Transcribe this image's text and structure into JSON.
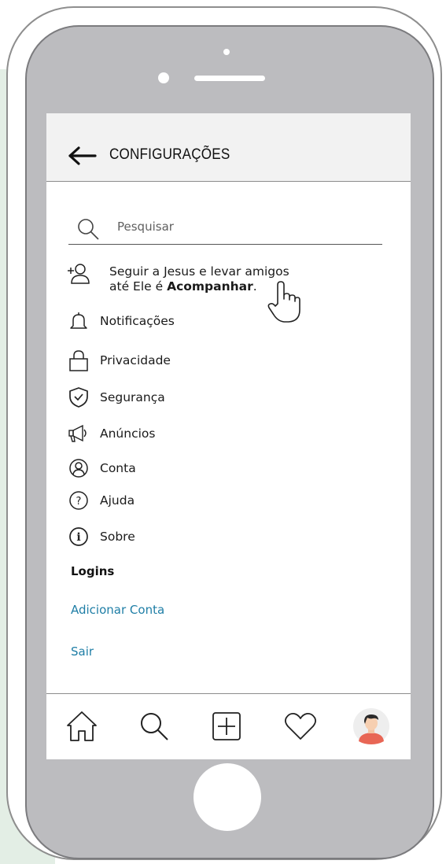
{
  "header": {
    "title": "CONFIGURAÇÕES",
    "back_icon": "arrow-left-icon"
  },
  "search": {
    "placeholder": "Pesquisar",
    "icon": "search-icon"
  },
  "follow": {
    "icon": "add-user-icon",
    "line1": "Seguir a Jesus e levar amigos",
    "line2_prefix": "até Ele é ",
    "line2_bold": "Acompanhar",
    "line2_suffix": ".",
    "cursor_icon": "hand-pointer-icon"
  },
  "menu": {
    "items": [
      {
        "label": "Notificações",
        "icon": "bell-icon"
      },
      {
        "label": "Privacidade",
        "icon": "lock-icon"
      },
      {
        "label": "Segurança",
        "icon": "shield-icon"
      },
      {
        "label": "Anúncios",
        "icon": "megaphone-icon"
      },
      {
        "label": "Conta",
        "icon": "account-icon"
      },
      {
        "label": "Ajuda",
        "icon": "help-icon"
      },
      {
        "label": "Sobre",
        "icon": "info-icon"
      }
    ]
  },
  "logins": {
    "heading": "Logins",
    "add_account": "Adicionar Conta",
    "logout": "Sair"
  },
  "colors": {
    "link": "#1f7ea6",
    "phone_body": "#bcbcbf",
    "background_panel": "#e3eee5"
  },
  "bottom_nav": [
    "home-icon",
    "search-icon",
    "add-post-icon",
    "heart-icon",
    "profile-avatar"
  ]
}
